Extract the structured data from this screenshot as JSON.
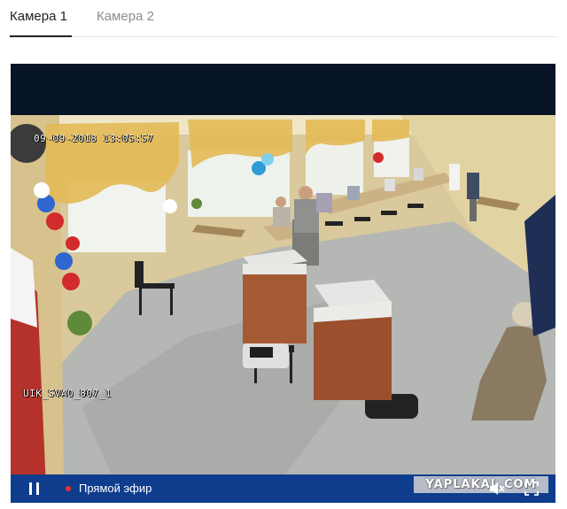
{
  "tabs": [
    {
      "label": "Камера 1",
      "active": true
    },
    {
      "label": "Камера 2",
      "active": false
    }
  ],
  "video": {
    "timestamp": "09-09-2018 13:05:57",
    "camera_id": "UIK_SVAO_807_1"
  },
  "controls": {
    "live_label": "Прямой эфир",
    "pause_icon": "pause-icon",
    "volume_icon": "volume-muted-icon",
    "fullscreen_icon": "fullscreen-icon",
    "watermark": "YAPLAKAL.COM"
  },
  "colors": {
    "controls_bg": "#0e3d8e",
    "player_bg": "#071426",
    "live_dot": "#e8322e"
  }
}
